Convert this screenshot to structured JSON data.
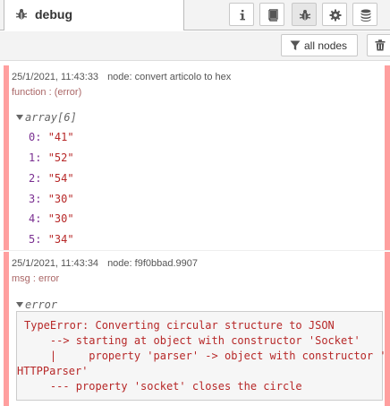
{
  "panel": {
    "title": "debug",
    "tabs": [
      "info-icon",
      "book-icon",
      "bug-icon",
      "gear-icon",
      "database-icon"
    ]
  },
  "toolbar": {
    "filter_label": "all nodes"
  },
  "messages": [
    {
      "timestamp": "25/1/2021, 11:43:33",
      "node": "node: convert articolo to hex",
      "topic": "function : (error)",
      "type_label": "array[6]",
      "items": [
        {
          "key": "0:",
          "value": "\"41\""
        },
        {
          "key": "1:",
          "value": "\"52\""
        },
        {
          "key": "2:",
          "value": "\"54\""
        },
        {
          "key": "3:",
          "value": "\"30\""
        },
        {
          "key": "4:",
          "value": "\"30\""
        },
        {
          "key": "5:",
          "value": "\"34\""
        }
      ]
    },
    {
      "timestamp": "25/1/2021, 11:43:34",
      "node": "node: f9f0bbad.9907",
      "topic": "msg : error",
      "type_label": "error",
      "error_lines": [
        "TypeError: Converting circular structure to JSON",
        "    --> starting at object with constructor 'Socket'",
        "    |     property 'parser' -> object with constructor '",
        "HTTPParser'",
        "    --- property 'socket' closes the circle"
      ]
    }
  ],
  "colors": {
    "error_bar": "#ff9f9f",
    "value_red": "#b72828",
    "key_purple": "#792e90"
  }
}
